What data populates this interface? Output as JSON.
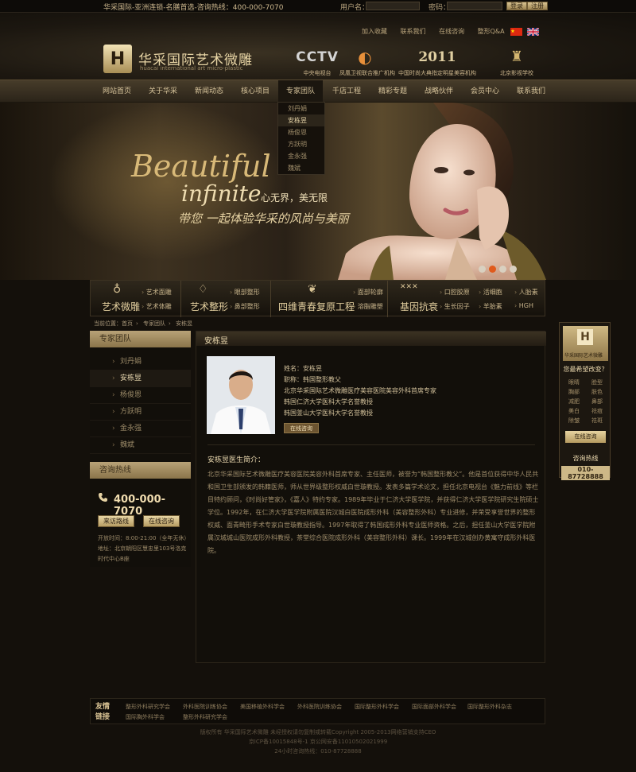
{
  "topbar": {
    "tagline": "华采国际-亚洲连锁-名膳首选-咨询热线：400-000-7070",
    "username_label": "用户名：",
    "password_label": "密码：",
    "login": "登录",
    "register": "注册"
  },
  "quicklinks": [
    "加入收藏",
    "联系我们",
    "在线咨询",
    "整形Q&A"
  ],
  "logo": {
    "cn": "华采国际艺术微雕",
    "en": "huacai international art micro-plastic",
    "mark": "H"
  },
  "media": [
    {
      "logo": "CCTV",
      "caption": "中央电视台"
    },
    {
      "logo": "◐",
      "caption": "凤凰卫视联合推广机构"
    },
    {
      "logo": "2011",
      "caption": "中国时尚大典指定明星美容机构"
    },
    {
      "logo": "♜",
      "caption": "北京影视学校"
    }
  ],
  "nav": [
    "网站首页",
    "关于华采",
    "新闻动态",
    "核心项目",
    "专家团队",
    "千店工程",
    "精彩专题",
    "战略伙伴",
    "会员中心",
    "联系我们"
  ],
  "dropdown": [
    "刘丹娟",
    "安栋昱",
    "杨俊恩",
    "方跃明",
    "金永强",
    "魏斌"
  ],
  "banner": {
    "title": "Beautiful",
    "subtitle": "infinite",
    "subtitle2": "心无界，美无限",
    "slogan": "带您 一起体验华采的风尚与美丽"
  },
  "services": [
    {
      "title": "艺术微雕",
      "icon": "♁",
      "links": [
        "艺术面雕",
        "艺术体雕"
      ]
    },
    {
      "title": "艺术整形",
      "icon": "♢",
      "links": [
        "眼部整形",
        "鼻部整形"
      ]
    },
    {
      "title": "四维青春复原工程",
      "icon": "❦",
      "links": [
        "面部轮廓",
        "溶脂雕塑"
      ]
    },
    {
      "title": "基因抗衰",
      "icon": "✕✕✕",
      "links": [
        "口腔胶原",
        "生长因子",
        "活细胞",
        "羊胎素",
        "人胎素",
        "HGH"
      ]
    }
  ],
  "breadcrumb": [
    "当前位置：首页",
    "专家团队",
    "安栋昱"
  ],
  "sidebar": {
    "head": "专家团队",
    "items": [
      "刘丹娟",
      "安栋昱",
      "杨俊恩",
      "方跃明",
      "金永强",
      "魏斌"
    ],
    "hotline_head": "咨询热线",
    "hotline": "400-000-7070",
    "route_btn": "来访路线",
    "consult_btn": "在线咨询",
    "hours": "开放时间：8:00-21:00（全年无休）",
    "address": "地址：北京朝阳区慧忠里103号洛克时代中心B座"
  },
  "doctor": {
    "title": "安栋昱",
    "name": "姓名：安栋昱",
    "role": "职称：韩国整形教父",
    "lines": [
      "北京华采国际艺术微雕医疗美容医院美容外科首席专家",
      "韩国仁济大学医科大学名誉教授",
      "韩国釜山大学医科大学名誉教授"
    ],
    "consult": "在线咨询",
    "intro_title": "安栋昱医生简介：",
    "intro": "北京华采国际艺术微雕医疗美容医院美容外科首席专家、主任医师，被誉为“韩国整形教父”。他是首位获得中华人民共和国卫生部颁发的韩籍医师，师从世界级整形权威白世璇教授。发表多篇学术论文，担任北京电视台《魅力前线》等栏目特约顾问，《时尚好管家》，《嘉人》特约专家。1989年毕业于仁济大学医学院，并获得仁济大学医学院研究生院硕士学位。1992年，在仁济大学医学院附属医院汉城白医院成形外科（美容整形外科）专业进修，并荣受享誉世界的整形权威、面青畸形手术专家白世璇教授指导。1997年取得了韩国成形外科专业医师资格。之后，担任釜山大学医学院附属汉城城山医院成形外科教授，茶堂综合医院成形外科（美容整形外科）课长。1999年在汉城创办黄寓守成形外科医院。"
  },
  "rightbox": {
    "logo_text": "华采国际艺术微雕",
    "question": "您最希望改变？",
    "tags": [
      "眼睛",
      "脸型",
      "胸部",
      "肤色",
      "减肥",
      "鼻部",
      "美白",
      "祛痘",
      "除皱",
      "祛斑"
    ],
    "btn": "在线咨询",
    "hot_label": "咨询热线",
    "tel": "010-87728888"
  },
  "friend_links": {
    "title": "友情链接",
    "items": [
      "整形外科研究学会",
      "外科医院训练协会",
      "美国移植外科学会",
      "外科医院训练协会",
      "国际整形外科学会",
      "国际面部外科学会",
      "国际整形外科杂志",
      "国际胸外科学会",
      "整形外科研究学会"
    ]
  },
  "footer": [
    "版权所有 华采国际艺术微雕 未经授权请勿复制或转载Copyright 2005-2013网络营销支持CEO",
    "京ICP备10015848号-1 京公网安备11010502021999",
    "24小时咨询热线：010-87728888"
  ]
}
